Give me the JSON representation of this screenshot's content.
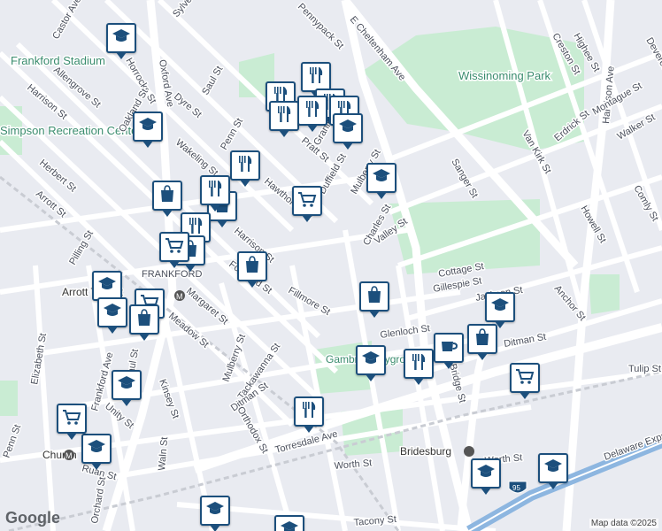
{
  "map": {
    "places": [
      {
        "name": "Frankford Stadium"
      },
      {
        "name": "Simpson Recreation Center"
      },
      {
        "name": "Wissinoming Park"
      },
      {
        "name": "Gambrel Playground"
      }
    ],
    "streets": [
      "Castor Ave",
      "Pennypack St",
      "Sylvester St",
      "Horrocks St",
      "Oxford Ave",
      "Allengrove St",
      "Harrison St",
      "Dyre St",
      "Saul St",
      "Oakland St",
      "Penn St",
      "Wakeling St",
      "Hawthorne St",
      "Pratt St",
      "Granite St",
      "Duffield St",
      "Herbert St",
      "Arrott St",
      "Pilling St",
      "Harrison St",
      "Fillmore St",
      "Foulkrod St",
      "Margaret St",
      "Meadow St",
      "Elizabeth St",
      "Frankford Ave",
      "Paul St",
      "Kinsey St",
      "Unity St",
      "Mulberry St",
      "Tackawanna St",
      "Ditman St",
      "Orthodox St",
      "Torresdale Ave",
      "Penn St",
      "Ruan St",
      "Orchard St",
      "Waln St",
      "Worth St",
      "Tacony St",
      "Charles St",
      "Valley St",
      "Cottage St",
      "Gillespie St",
      "Jackson St",
      "Glenloch St",
      "Bridge St",
      "Anchor St",
      "Tulip St",
      "Sanger St",
      "E Cheltenham Ave",
      "Van Kirk St",
      "Erdrick St",
      "Harbison Ave",
      "Montague St",
      "Walker St",
      "Comly St",
      "Highee St",
      "Creston St",
      "Devereaux St",
      "Howell St",
      "Ditman St",
      "Delaware Expressway",
      "Mulberry St",
      "Worth St"
    ],
    "transit": [
      "Church",
      "Arrott Transit",
      "Bridesburg"
    ],
    "shields": [
      "95"
    ],
    "frankford_label": "FRANKFORD",
    "pins": [
      {
        "type": "school"
      },
      {
        "type": "restaurant"
      },
      {
        "type": "restaurant"
      },
      {
        "type": "restaurant"
      },
      {
        "type": "school"
      },
      {
        "type": "restaurant"
      },
      {
        "type": "restaurant"
      },
      {
        "type": "restaurant"
      },
      {
        "type": "school"
      },
      {
        "type": "restaurant"
      },
      {
        "type": "shopping"
      },
      {
        "type": "shopping"
      },
      {
        "type": "grocery"
      },
      {
        "type": "school"
      },
      {
        "type": "restaurant"
      },
      {
        "type": "restaurant"
      },
      {
        "type": "shopping"
      },
      {
        "type": "shopping"
      },
      {
        "type": "school"
      },
      {
        "type": "grocery"
      },
      {
        "type": "school"
      },
      {
        "type": "shopping"
      },
      {
        "type": "shopping"
      },
      {
        "type": "school"
      },
      {
        "type": "school"
      },
      {
        "type": "restaurant"
      },
      {
        "type": "coffee"
      },
      {
        "type": "shopping"
      },
      {
        "type": "school"
      },
      {
        "type": "grocery"
      },
      {
        "type": "school"
      },
      {
        "type": "restaurant"
      },
      {
        "type": "grocery"
      },
      {
        "type": "school"
      },
      {
        "type": "school"
      },
      {
        "type": "school"
      },
      {
        "type": "school"
      },
      {
        "type": "grocery"
      }
    ]
  },
  "footer": {
    "logo": "Google",
    "attribution": "Map data ©2025"
  }
}
